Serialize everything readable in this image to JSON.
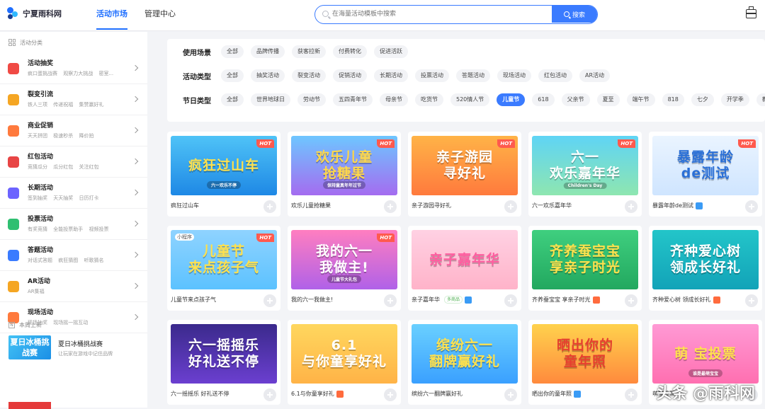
{
  "brand": {
    "name": "宁夏雨科网"
  },
  "nav": {
    "market": "活动市场",
    "manage": "管理中心"
  },
  "search": {
    "placeholder": "在海量活动模板中搜索",
    "button": "搜索"
  },
  "sidebar": {
    "heading": "活动分类",
    "items": [
      {
        "title": "活动抽奖",
        "sub": "疯口蛋挑战赛 观察力大挑战 密室...",
        "icon": "gift-icon",
        "color": "#f04a44"
      },
      {
        "title": "裂变引流",
        "sub": "铁人三项 传递祝福 集赞赢好礼",
        "icon": "user-icon",
        "color": "#f5a623"
      },
      {
        "title": "商业促销",
        "sub": "天天拼团 极速秒杀 降价拍",
        "icon": "tag-icon",
        "color": "#ff7a3d"
      },
      {
        "title": "红包活动",
        "sub": "竞猜瓜分 瓜分红包 关注红包",
        "icon": "red-envelope-icon",
        "color": "#e84545"
      },
      {
        "title": "长期活动",
        "sub": "签到抽奖 天天抽奖 日历打卡",
        "icon": "calendar-icon",
        "color": "#6c63ff"
      },
      {
        "title": "投票活动",
        "sub": "有奖竞猜 全能投票助手 视频投票",
        "icon": "vote-icon",
        "color": "#2fbf71"
      },
      {
        "title": "答题活动",
        "sub": "对话式答题 疯狂猜图 听歌猜名",
        "icon": "question-icon",
        "color": "#3a7bff"
      },
      {
        "title": "AR活动",
        "sub": "AR集福",
        "icon": "ar-icon",
        "color": "#f5a623"
      },
      {
        "title": "现场活动",
        "sub": "现场抽奖 现场摇一摇互动",
        "icon": "live-icon",
        "color": "#ff7a3d"
      }
    ],
    "new_heading": "本周上新",
    "new_items": [
      {
        "title": "夏日冰桶挑战赛",
        "sub": "让玩家在游戏中记住品牌",
        "thumb_text": "夏日冰桶挑战赛"
      }
    ]
  },
  "filters": [
    {
      "label": "使用场景",
      "tags": [
        "全部",
        "品牌传播",
        "获客拉新",
        "付费转化",
        "促进活跃"
      ],
      "selected": null
    },
    {
      "label": "活动类型",
      "tags": [
        "全部",
        "抽奖活动",
        "裂变活动",
        "促销活动",
        "长期活动",
        "投票活动",
        "答题活动",
        "现场活动",
        "红包活动",
        "AR活动"
      ],
      "selected": null
    },
    {
      "label": "节日类型",
      "tags": [
        "全部",
        "世界地球日",
        "劳动节",
        "五四青年节",
        "母亲节",
        "吃货节",
        "520情人节",
        "儿童节",
        "618",
        "父亲节",
        "夏至",
        "端午节",
        "818",
        "七夕",
        "开学季",
        "教师"
      ],
      "selected": 7
    }
  ],
  "cards": [
    {
      "title": "疯狂过山车",
      "thumb": "疯狂过山车",
      "sub": "六一欢乐不停",
      "hot": "HOT",
      "bg": "linear-gradient(180deg,#4fc3f7,#1e88e5)",
      "fg": "#ffe14d",
      "badge": null
    },
    {
      "title": "欢乐儿童抢糖果",
      "thumb": "欢乐儿童\n抢糖果",
      "sub": "保持童真年年过节",
      "hot": "HOT",
      "bg": "linear-gradient(180deg,#6ec6ff,#a46cf0)",
      "fg": "#ffd84a",
      "badge": null
    },
    {
      "title": "亲子游园寻好礼",
      "thumb": "亲子游园\n寻好礼",
      "sub": "",
      "hot": "HOT",
      "bg": "linear-gradient(180deg,#ffb347,#ff7a3d)",
      "fg": "#ffffff",
      "badge": null
    },
    {
      "title": "六一欢乐嘉年华",
      "thumb": "六一\n欢乐嘉年华",
      "sub": "Children's Day",
      "hot": "HOT",
      "bg": "linear-gradient(180deg,#5fd4f5,#8ee6b0)",
      "fg": "#ffffff",
      "badge": null
    },
    {
      "title": "暴露年龄de测试",
      "thumb": "暴露年龄\nde测试",
      "sub": "",
      "hot": "HOT",
      "bg": "linear-gradient(180deg,#eaf4ff,#cfe5ff)",
      "fg": "#2a6fd6",
      "badge": "b"
    },
    {
      "title": "儿童节来点孩子气",
      "thumb": "儿童节\n来点孩子气",
      "sub": "",
      "hot": "HOT",
      "bg": "linear-gradient(180deg,#8fd3ff,#5cc2ff)",
      "fg": "#ffe14d",
      "badge": null,
      "mini": "小程序"
    },
    {
      "title": "我的六一我做主!",
      "thumb": "我的六一\n我做主!",
      "sub": "儿童节大礼包",
      "hot": "HOT",
      "bg": "linear-gradient(180deg,#ff7ec0,#b061e8)",
      "fg": "#ffffff",
      "badge": null
    },
    {
      "title": "亲子嘉年华",
      "thumb": "亲子嘉年华",
      "sub": "",
      "hot": "",
      "bg": "linear-gradient(180deg,#ffd1e3,#ffb3c9)",
      "fg": "#ff5ea0",
      "badge": "b",
      "multi": "多商品"
    },
    {
      "title": "齐养蚕宝宝 享亲子时光",
      "thumb": "齐养蚕宝宝\n享亲子时光",
      "sub": "",
      "hot": "",
      "bg": "linear-gradient(180deg,#3fcf7f,#22a85f)",
      "fg": "#ffe14d",
      "badge": "r"
    },
    {
      "title": "齐种爱心树 领成长好礼",
      "thumb": "齐种爱心树\n领成长好礼",
      "sub": "",
      "hot": "",
      "bg": "linear-gradient(180deg,#23c5c9,#12a3b8)",
      "fg": "#ffffff",
      "badge": "r"
    },
    {
      "title": "六一摇摇乐 好礼送不停",
      "thumb": "六一摇摇乐\n好礼送不停",
      "sub": "",
      "hot": "",
      "bg": "linear-gradient(180deg,#3b2a8c,#6b3fd0)",
      "fg": "#ffffff",
      "badge": null
    },
    {
      "title": "6.1与你童享好礼",
      "thumb": "6.1\n与你童享好礼",
      "sub": "",
      "hot": "",
      "bg": "linear-gradient(180deg,#ffd75e,#ffb347)",
      "fg": "#ffffff",
      "badge": "r"
    },
    {
      "title": "缤纷六一翻牌赢好礼",
      "thumb": "缤纷六一\n翻牌赢好礼",
      "sub": "",
      "hot": "",
      "bg": "linear-gradient(180deg,#6ad0ff,#3aa0ff)",
      "fg": "#ffe14d",
      "badge": null
    },
    {
      "title": "晒出你的童年照",
      "thumb": "晒出你的\n童年照",
      "sub": "",
      "hot": "",
      "bg": "linear-gradient(180deg,#ffd24d,#ff8a3d)",
      "fg": "#e6402f",
      "badge": "b"
    },
    {
      "title": "萌宝投票",
      "thumb": "萌 宝投票",
      "sub": "谁是最萌宝宝",
      "hot": "",
      "bg": "linear-gradient(180deg,#ff9ad5,#ff6fb0)",
      "fg": "#ffe14d",
      "badge": null
    }
  ],
  "watermark": "头条 @雨科网"
}
